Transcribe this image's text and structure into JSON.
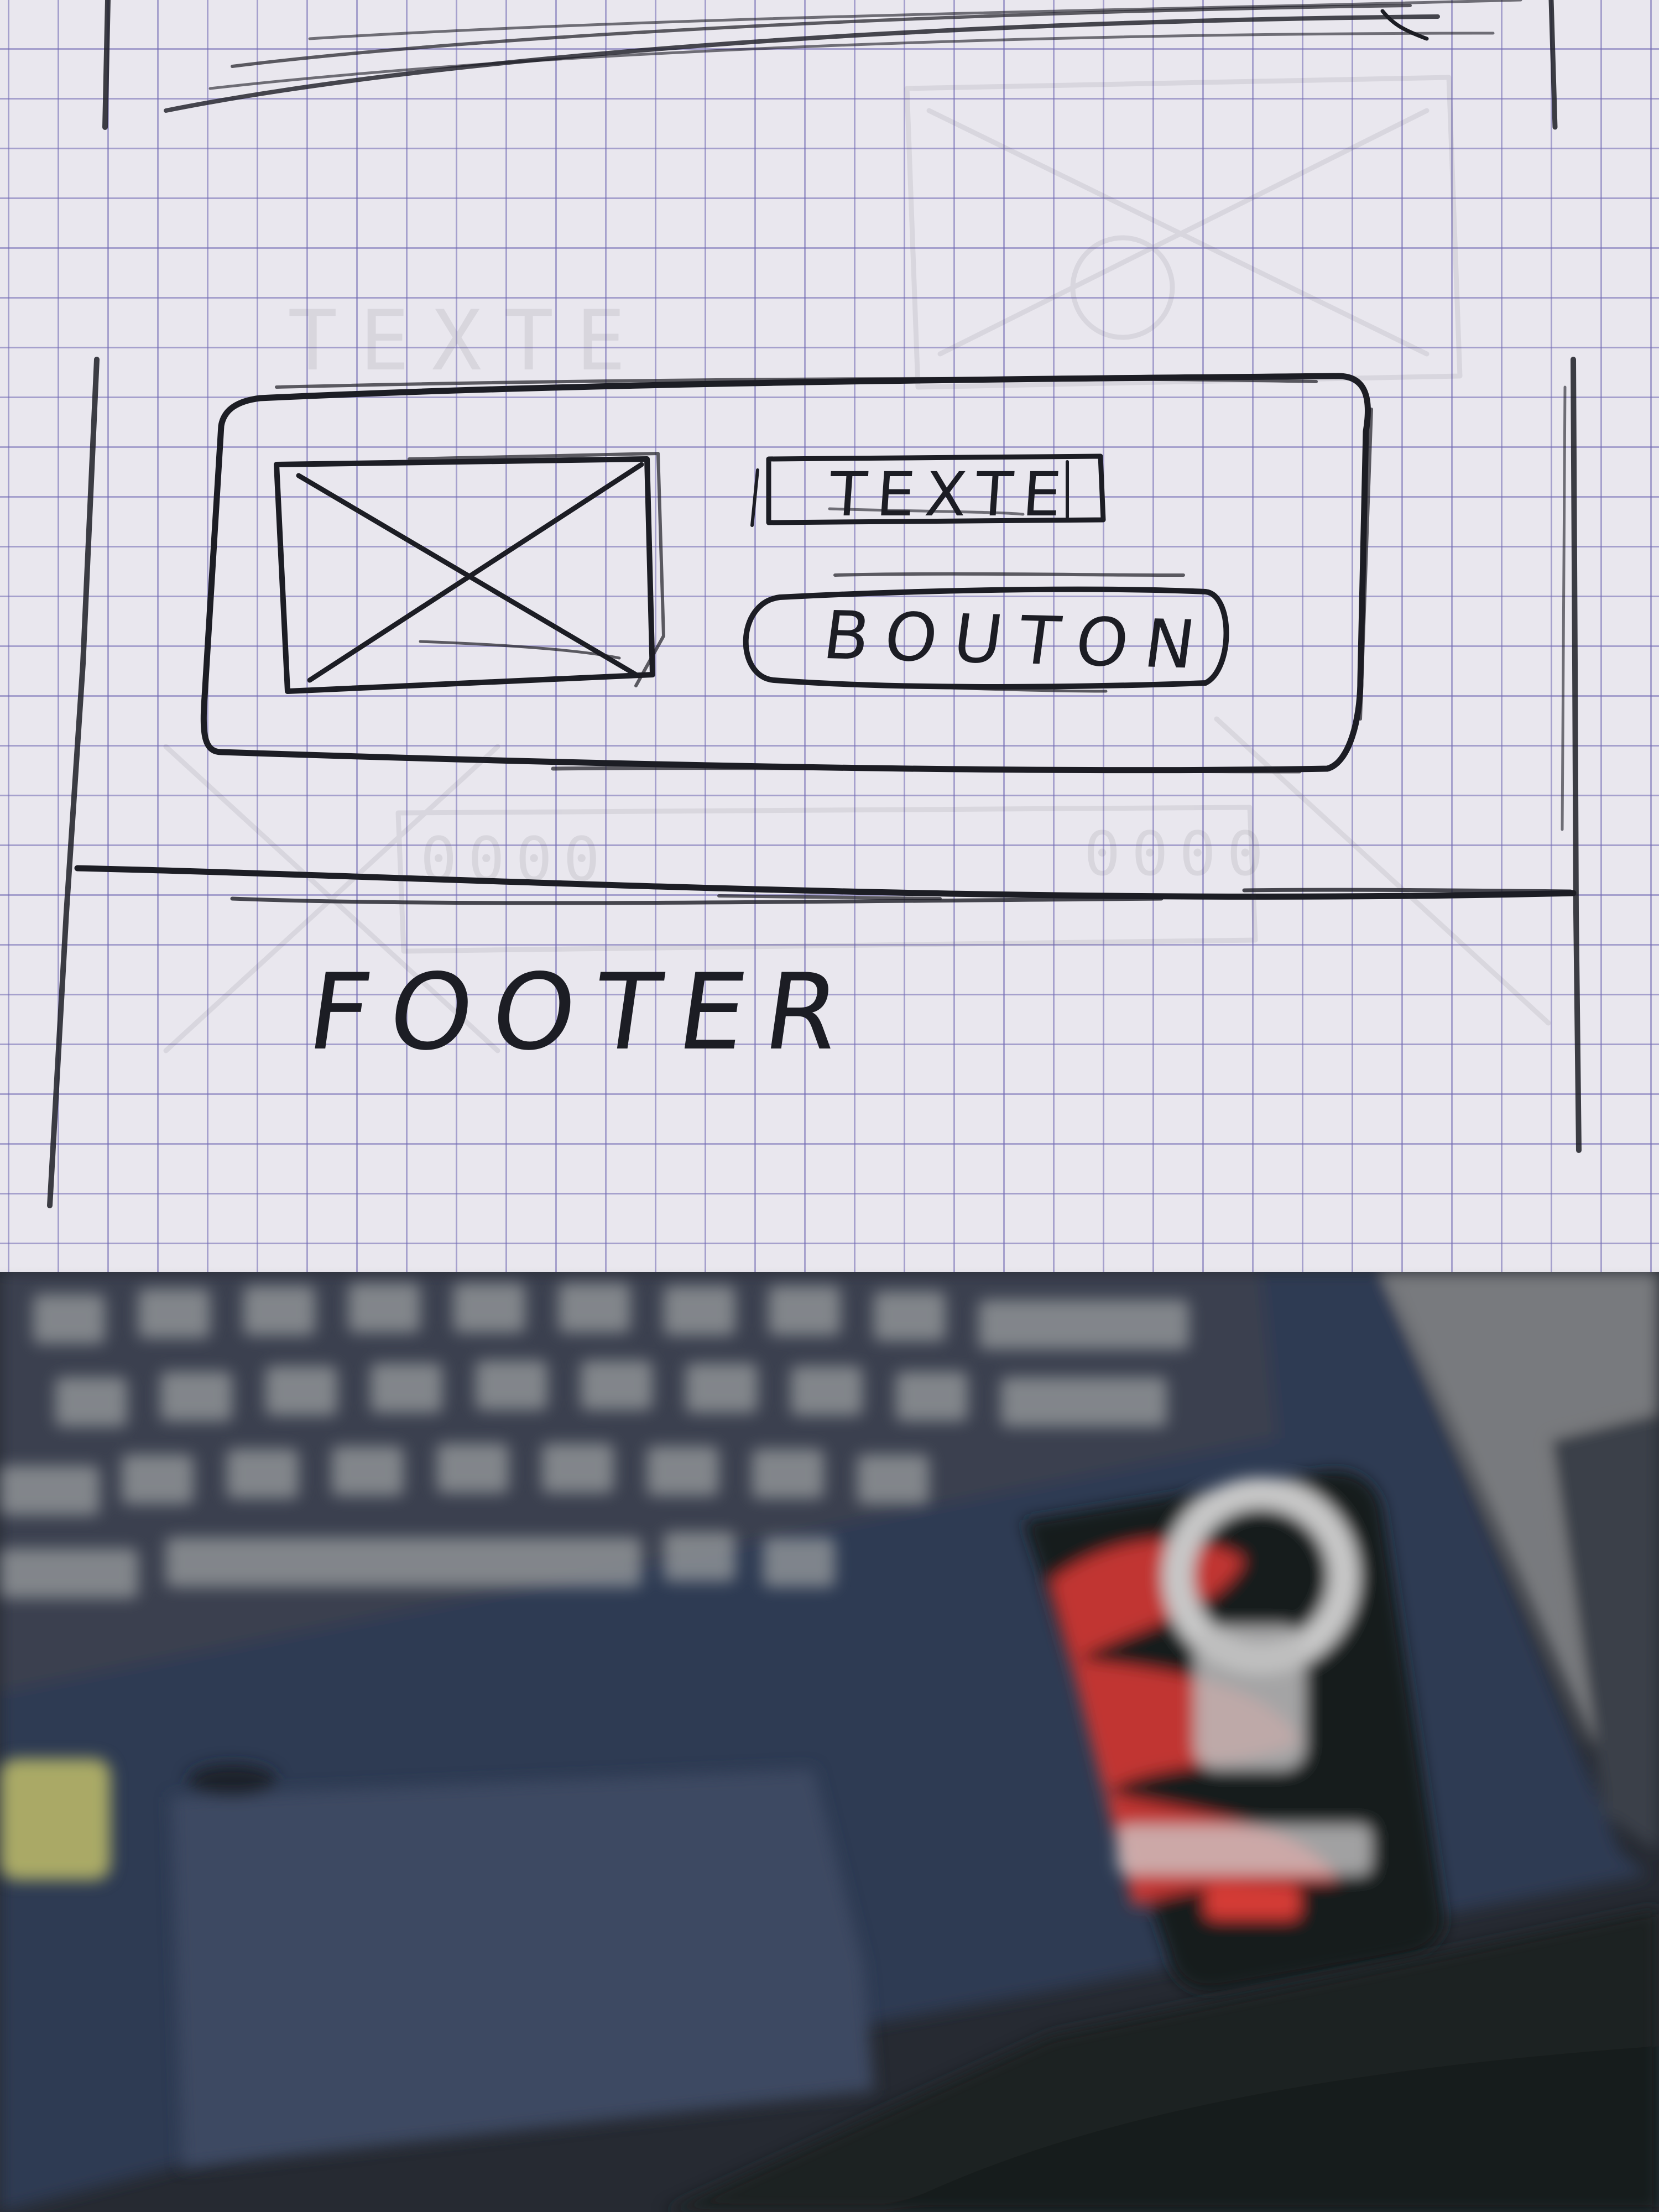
{
  "sketch": {
    "text_box_label": "TEXTE",
    "button_label": "BOUTON",
    "footer_label": "FOOTER"
  },
  "colors": {
    "paper": "#e9e7ee",
    "grid": "#7068b2",
    "pencil": "#1c1d24",
    "laptop_body": "#2f3b52",
    "sticker_red": "#d43a35"
  },
  "background": {
    "icons": [
      "laptop-keyboard",
      "trackpad",
      "sticker-logo"
    ]
  }
}
